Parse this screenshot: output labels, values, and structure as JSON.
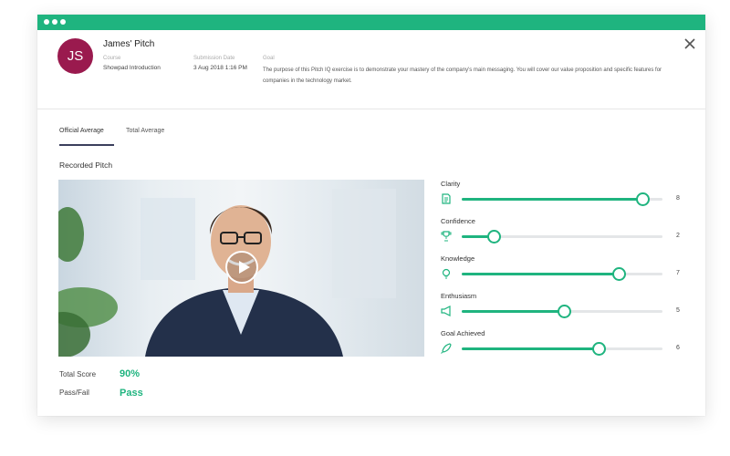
{
  "window": {
    "accent": "#1fb47f",
    "close_icon": "close-icon"
  },
  "header": {
    "avatar_initials": "JS",
    "avatar_color": "#9a1a4e",
    "title": "James' Pitch",
    "course_label": "Course",
    "course_value": "Showpad Introduction",
    "submission_label": "Submission Date",
    "submission_value": "3 Aug 2018 1:16 PM",
    "goal_label": "Goal",
    "goal_text": "The purpose of this Pitch IQ exercise is to demonstrate your mastery of the company's main messaging. You will cover our value proposition and specific features for companies in the technology market."
  },
  "tabs": [
    {
      "label": "Official Average",
      "active": true
    },
    {
      "label": "Total Average",
      "active": false
    }
  ],
  "recorded": {
    "title": "Recorded Pitch",
    "play_icon": "play-icon"
  },
  "scores": {
    "total_label": "Total Score",
    "total_value": "90%",
    "passfail_label": "Pass/Fail",
    "passfail_value": "Pass"
  },
  "metrics": [
    {
      "name": "Clarity",
      "icon": "document-icon",
      "value": "8",
      "level": 0.9
    },
    {
      "name": "Confidence",
      "icon": "trophy-icon",
      "value": "2",
      "level": 0.16
    },
    {
      "name": "Knowledge",
      "icon": "lightbulb-icon",
      "value": "7",
      "level": 0.78
    },
    {
      "name": "Enthusiasm",
      "icon": "megaphone-icon",
      "value": "5",
      "level": 0.51
    },
    {
      "name": "Goal Achieved",
      "icon": "rocket-icon",
      "value": "6",
      "level": 0.68
    }
  ]
}
